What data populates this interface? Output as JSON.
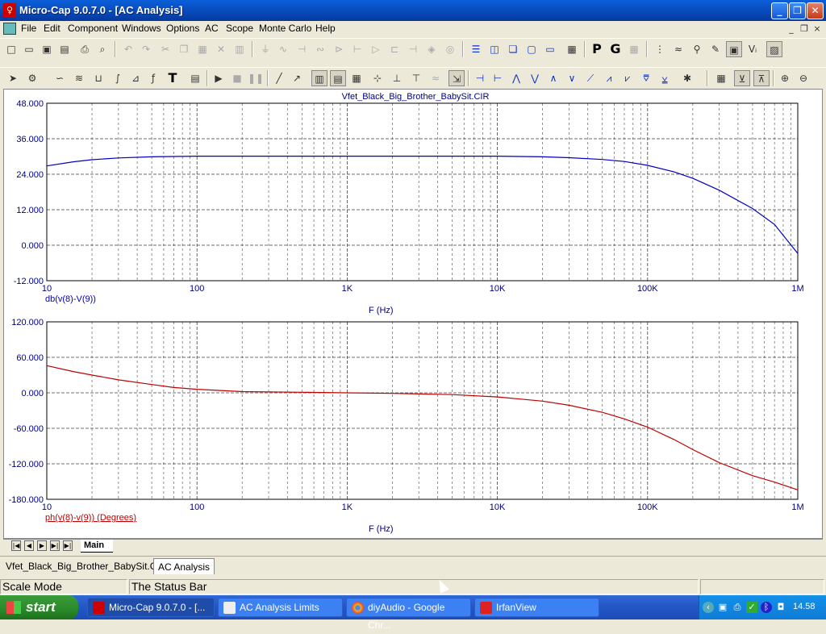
{
  "window": {
    "title": "Micro-Cap 9.0.7.0 - [AC Analysis]"
  },
  "menu": [
    "File",
    "Edit",
    "Component",
    "Windows",
    "Options",
    "AC",
    "Scope",
    "Monte Carlo",
    "Help"
  ],
  "plot_title": "Vfet_Black_Big_Brother_BabySit.CIR",
  "tabs": {
    "main": "Main"
  },
  "doc_tabs": [
    "Vfet_Black_Big_Brother_BabySit.CIR",
    "AC Analysis"
  ],
  "status": {
    "mode": "Scale Mode",
    "message": "The Status Bar"
  },
  "taskbar": {
    "start": "start",
    "tasks": [
      "Micro-Cap 9.0.7.0 - [...",
      "AC Analysis Limits",
      "diyAudio - Google Chr...",
      "IrfanView"
    ],
    "clock": "14.58"
  },
  "chart_data": [
    {
      "type": "line",
      "x_scale": "log",
      "xlim": [
        10,
        1000000
      ],
      "ylim": [
        -12,
        48
      ],
      "x_ticks": [
        "10",
        "100",
        "1K",
        "10K",
        "100K",
        "1M"
      ],
      "y_ticks": [
        "48.000",
        "36.000",
        "24.000",
        "12.000",
        "0.000",
        "-12.000"
      ],
      "xlabel": "F (Hz)",
      "ylabel": "",
      "grid": true,
      "series": [
        {
          "name": "db(v(8)-V(9))",
          "color": "#0000c0",
          "x": [
            10,
            15,
            20,
            30,
            50,
            70,
            100,
            1000,
            10000,
            20000,
            30000,
            50000,
            70000,
            100000,
            150000,
            200000,
            300000,
            500000,
            700000,
            1000000
          ],
          "y": [
            26.8,
            28.2,
            28.9,
            29.5,
            29.9,
            30.0,
            30.1,
            30.1,
            30.1,
            29.9,
            29.6,
            29.0,
            28.3,
            27.0,
            24.8,
            22.6,
            18.6,
            12.4,
            7.0,
            -2.8
          ]
        }
      ]
    },
    {
      "type": "line",
      "x_scale": "log",
      "xlim": [
        10,
        1000000
      ],
      "ylim": [
        -180,
        120
      ],
      "x_ticks": [
        "10",
        "100",
        "1K",
        "10K",
        "100K",
        "1M"
      ],
      "y_ticks": [
        "120.000",
        "60.000",
        "0.000",
        "-60.000",
        "-120.000",
        "-180.000"
      ],
      "xlabel": "F (Hz)",
      "ylabel": "",
      "grid": true,
      "series": [
        {
          "name": "ph(v(8)-v(9)) (Degrees)",
          "color": "#c00000",
          "x": [
            10,
            15,
            20,
            30,
            50,
            70,
            100,
            200,
            500,
            1000,
            2000,
            5000,
            10000,
            20000,
            30000,
            50000,
            70000,
            100000,
            150000,
            200000,
            300000,
            500000,
            700000,
            1000000
          ],
          "y": [
            46,
            36,
            30,
            22,
            14,
            9,
            6,
            2,
            1,
            0,
            -1,
            -3,
            -7,
            -14,
            -21,
            -33,
            -44,
            -58,
            -79,
            -96,
            -118,
            -140,
            -151,
            -164
          ]
        }
      ]
    }
  ],
  "icons": {
    "toolbar1": [
      "new-icon",
      "open-icon",
      "save-icon",
      "save-all-icon",
      "print-icon",
      "print-preview-icon",
      "undo-icon",
      "redo-icon",
      "cut-icon",
      "copy-icon",
      "paste-icon",
      "delete-icon",
      "select-all-icon"
    ],
    "colors": {
      "title_blue": "#0848b8",
      "gain_curve": "#0000c0",
      "phase_curve": "#c00000",
      "axis_label": "#000080"
    }
  }
}
